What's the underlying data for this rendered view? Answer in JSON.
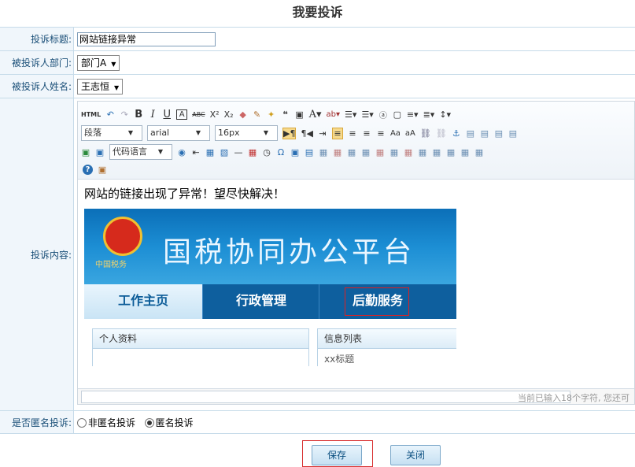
{
  "page": {
    "title": "我要投诉"
  },
  "form": {
    "title_label": "投诉标题:",
    "title_value": "网站链接异常",
    "dept_label": "被投诉人部门:",
    "dept_value": "部门A",
    "name_label": "被投诉人姓名:",
    "name_value": "王志恒",
    "content_label": "投诉内容:",
    "anon_label": "是否匿名投诉:",
    "anon_options": [
      "非匿名投诉",
      "匿名投诉"
    ],
    "anon_selected": "匿名投诉"
  },
  "editor": {
    "paragraph_select": "段落",
    "font_select": "arial",
    "size_select": "16px",
    "code_select": "代码语言",
    "content_text": "网站的链接出现了异常！望尽快解决！",
    "status_text": "当前已输入18个字符, 您还可",
    "html_label": "HTML"
  },
  "screenshot": {
    "banner_title": "国税协同办公平台",
    "emblem_caption": "中国税务",
    "tabs": [
      "工作主页",
      "行政管理",
      "后勤服务"
    ],
    "panels": [
      "个人资料",
      "信息列表"
    ],
    "list_item": "xx标题"
  },
  "buttons": {
    "save": "保存",
    "close": "关闭"
  },
  "colors": {
    "label_bg": "#f0f6fb",
    "label_text": "#1a4f78",
    "border": "#c6dbe9",
    "highlight": "#e02020"
  }
}
